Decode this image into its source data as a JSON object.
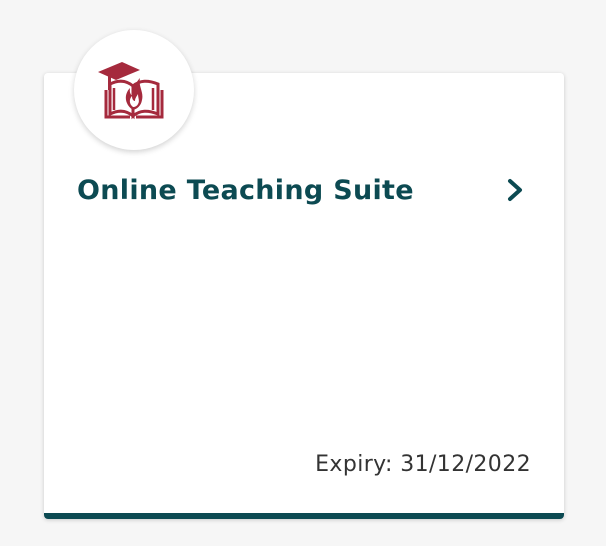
{
  "product_card": {
    "title": "Online Teaching Suite",
    "expiry": "Expiry: 31/12/2022",
    "logo_icon": "book-with-graduation-cap-and-flame-icon",
    "action_icon": "chevron-right-icon",
    "colors": {
      "title": "#0c4a52",
      "accent_bar": "#0c4a52",
      "logo": "#a52a3d",
      "expiry_text": "#333333",
      "background": "#f6f6f6",
      "card": "#ffffff"
    }
  }
}
